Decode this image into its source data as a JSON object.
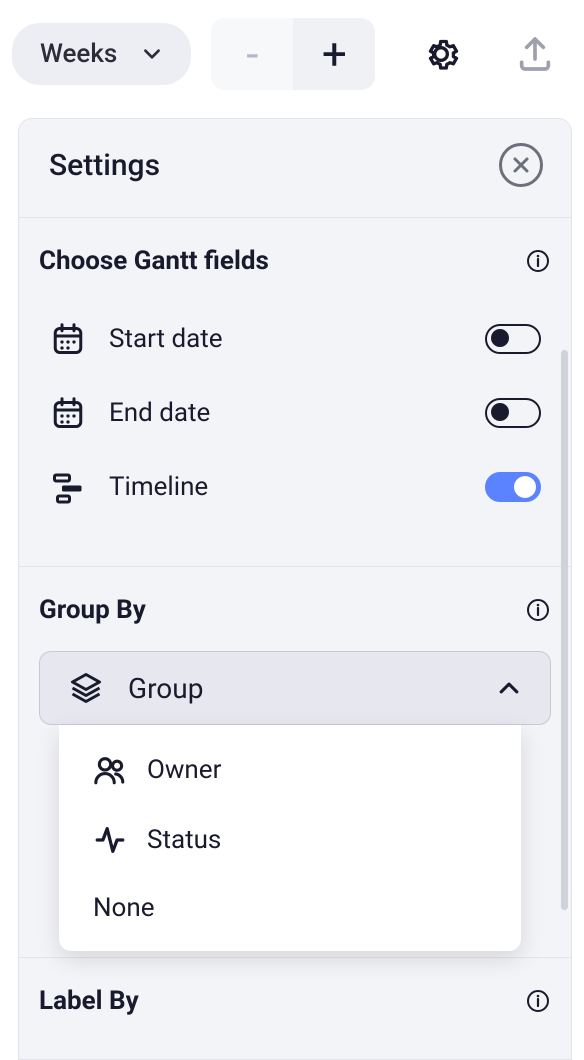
{
  "toolbar": {
    "timescale_label": "Weeks",
    "zoom_out": "-",
    "zoom_in": "+"
  },
  "panel": {
    "title": "Settings"
  },
  "gantt_fields": {
    "title": "Choose Gantt fields",
    "items": [
      {
        "label": "Start date",
        "icon": "calendar",
        "on": false
      },
      {
        "label": "End date",
        "icon": "calendar",
        "on": false
      },
      {
        "label": "Timeline",
        "icon": "timeline",
        "on": true
      }
    ]
  },
  "group_by": {
    "title": "Group By",
    "selected": "Group",
    "open": true,
    "options": [
      {
        "label": "Owner",
        "icon": "people"
      },
      {
        "label": "Status",
        "icon": "activity"
      },
      {
        "label": "None",
        "icon": ""
      }
    ]
  },
  "label_by": {
    "title": "Label By"
  }
}
